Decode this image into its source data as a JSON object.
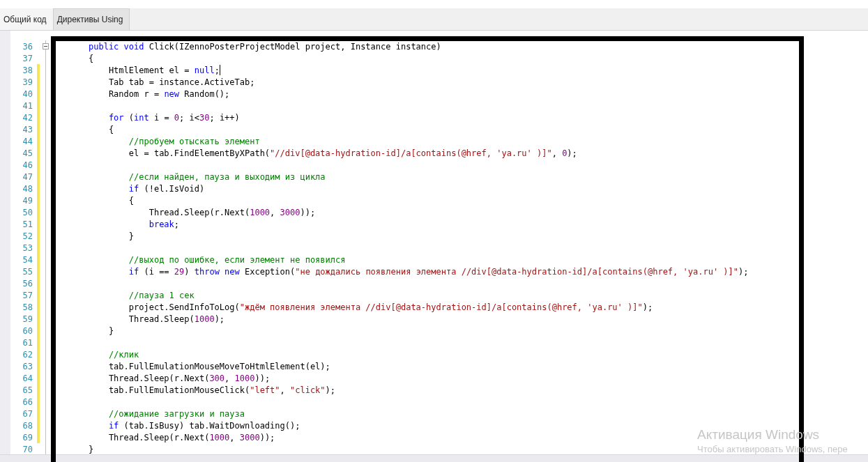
{
  "tabs": [
    {
      "label": "Общий код",
      "selected": true
    },
    {
      "label": "Директивы Using",
      "selected": false
    }
  ],
  "editor": {
    "lines": [
      {
        "number": "36",
        "changed": false,
        "fold_toggle": true,
        "caret": false,
        "tokens": [
          {
            "kind": "keyword",
            "text": "public"
          },
          {
            "kind": "keyword",
            "text": " void"
          },
          {
            "kind": "plain",
            "text": " Click(IZennoPosterProjectModel project, Instance instance)"
          }
        ]
      },
      {
        "number": "37",
        "changed": false,
        "fold_toggle": false,
        "caret": false,
        "tokens": [
          {
            "kind": "plain",
            "text": "{"
          }
        ]
      },
      {
        "number": "38",
        "changed": true,
        "fold_toggle": false,
        "caret": true,
        "tokens": [
          {
            "kind": "plain",
            "text": "    HtmlElement el = "
          },
          {
            "kind": "keyword",
            "text": "null"
          },
          {
            "kind": "plain",
            "text": ";"
          }
        ]
      },
      {
        "number": "39",
        "changed": true,
        "fold_toggle": false,
        "caret": false,
        "tokens": [
          {
            "kind": "plain",
            "text": "    Tab tab = instance.ActiveTab;"
          }
        ]
      },
      {
        "number": "40",
        "changed": true,
        "fold_toggle": false,
        "caret": false,
        "tokens": [
          {
            "kind": "plain",
            "text": "    Random r = "
          },
          {
            "kind": "keyword",
            "text": "new"
          },
          {
            "kind": "plain",
            "text": " Random();"
          }
        ]
      },
      {
        "number": "41",
        "changed": true,
        "fold_toggle": false,
        "caret": false
      },
      {
        "number": "42",
        "changed": true,
        "fold_toggle": false,
        "caret": false,
        "tokens": [
          {
            "kind": "keyword",
            "text": "    for"
          },
          {
            "kind": "plain",
            "text": " ("
          },
          {
            "kind": "keyword",
            "text": "int"
          },
          {
            "kind": "plain",
            "text": " i = "
          },
          {
            "kind": "number",
            "text": "0"
          },
          {
            "kind": "plain",
            "text": "; i<"
          },
          {
            "kind": "number",
            "text": "30"
          },
          {
            "kind": "plain",
            "text": "; i++)"
          }
        ]
      },
      {
        "number": "43",
        "changed": true,
        "fold_toggle": false,
        "caret": false,
        "tokens": [
          {
            "kind": "plain",
            "text": "    {"
          }
        ]
      },
      {
        "number": "44",
        "changed": true,
        "fold_toggle": false,
        "caret": false,
        "tokens": [
          {
            "kind": "comment",
            "text": "        //пробуем отыскать элемент"
          }
        ]
      },
      {
        "number": "45",
        "changed": true,
        "fold_toggle": false,
        "caret": false,
        "tokens": [
          {
            "kind": "plain",
            "text": "        el = tab.FindElementByXPath("
          },
          {
            "kind": "string",
            "text": "\"//div[@data-hydration-id]/a[contains(@href, 'ya.ru' )]\""
          },
          {
            "kind": "plain",
            "text": ", "
          },
          {
            "kind": "number",
            "text": "0"
          },
          {
            "kind": "plain",
            "text": ");"
          }
        ]
      },
      {
        "number": "46",
        "changed": true,
        "fold_toggle": false,
        "caret": false
      },
      {
        "number": "47",
        "changed": true,
        "fold_toggle": false,
        "caret": false,
        "tokens": [
          {
            "kind": "comment",
            "text": "        //если найден, пауза и выходим из цикла"
          }
        ]
      },
      {
        "number": "48",
        "changed": true,
        "fold_toggle": false,
        "caret": false,
        "tokens": [
          {
            "kind": "keyword",
            "text": "        if"
          },
          {
            "kind": "plain",
            "text": " (!el.IsVoid)"
          }
        ]
      },
      {
        "number": "49",
        "changed": true,
        "fold_toggle": false,
        "caret": false,
        "tokens": [
          {
            "kind": "plain",
            "text": "        {"
          }
        ]
      },
      {
        "number": "50",
        "changed": true,
        "fold_toggle": false,
        "caret": false,
        "tokens": [
          {
            "kind": "plain",
            "text": "            Thread.Sleep(r.Next("
          },
          {
            "kind": "number",
            "text": "1000"
          },
          {
            "kind": "plain",
            "text": ", "
          },
          {
            "kind": "number",
            "text": "3000"
          },
          {
            "kind": "plain",
            "text": "));"
          }
        ]
      },
      {
        "number": "51",
        "changed": true,
        "fold_toggle": false,
        "caret": false,
        "tokens": [
          {
            "kind": "keyword",
            "text": "            break"
          },
          {
            "kind": "plain",
            "text": ";"
          }
        ]
      },
      {
        "number": "52",
        "changed": true,
        "fold_toggle": false,
        "caret": false,
        "tokens": [
          {
            "kind": "plain",
            "text": "        }"
          }
        ]
      },
      {
        "number": "53",
        "changed": true,
        "fold_toggle": false,
        "caret": false
      },
      {
        "number": "54",
        "changed": true,
        "fold_toggle": false,
        "caret": false,
        "tokens": [
          {
            "kind": "comment",
            "text": "        //выход по ошибке, если элемент не появился"
          }
        ]
      },
      {
        "number": "55",
        "changed": true,
        "fold_toggle": false,
        "caret": false,
        "tokens": [
          {
            "kind": "keyword",
            "text": "        if"
          },
          {
            "kind": "plain",
            "text": " (i == "
          },
          {
            "kind": "number",
            "text": "29"
          },
          {
            "kind": "plain",
            "text": ") "
          },
          {
            "kind": "keyword",
            "text": "throw"
          },
          {
            "kind": "keyword",
            "text": " new"
          },
          {
            "kind": "plain",
            "text": " Exception("
          },
          {
            "kind": "string",
            "text": "\"не дождались появления элемента //div[@data-hydration-id]/a[contains(@href, 'ya.ru' )]\""
          },
          {
            "kind": "plain",
            "text": ");"
          }
        ]
      },
      {
        "number": "56",
        "changed": true,
        "fold_toggle": false,
        "caret": false
      },
      {
        "number": "57",
        "changed": true,
        "fold_toggle": false,
        "caret": false,
        "tokens": [
          {
            "kind": "comment",
            "text": "        //пауза 1 сек"
          }
        ]
      },
      {
        "number": "58",
        "changed": true,
        "fold_toggle": false,
        "caret": false,
        "tokens": [
          {
            "kind": "plain",
            "text": "        project.SendInfoToLog("
          },
          {
            "kind": "string",
            "text": "\"ждём появления элемента //div[@data-hydration-id]/a[contains(@href, 'ya.ru' )]\""
          },
          {
            "kind": "plain",
            "text": ");"
          }
        ]
      },
      {
        "number": "59",
        "changed": true,
        "fold_toggle": false,
        "caret": false,
        "tokens": [
          {
            "kind": "plain",
            "text": "        Thread.Sleep("
          },
          {
            "kind": "number",
            "text": "1000"
          },
          {
            "kind": "plain",
            "text": ");"
          }
        ]
      },
      {
        "number": "60",
        "changed": true,
        "fold_toggle": false,
        "caret": false,
        "tokens": [
          {
            "kind": "plain",
            "text": "    }"
          }
        ]
      },
      {
        "number": "61",
        "changed": true,
        "fold_toggle": false,
        "caret": false
      },
      {
        "number": "62",
        "changed": true,
        "fold_toggle": false,
        "caret": false,
        "tokens": [
          {
            "kind": "comment",
            "text": "    //клик"
          }
        ]
      },
      {
        "number": "63",
        "changed": true,
        "fold_toggle": false,
        "caret": false,
        "tokens": [
          {
            "kind": "plain",
            "text": "    tab.FullEmulationMouseMoveToHtmlElement(el);"
          }
        ]
      },
      {
        "number": "64",
        "changed": true,
        "fold_toggle": false,
        "caret": false,
        "tokens": [
          {
            "kind": "plain",
            "text": "    Thread.Sleep(r.Next("
          },
          {
            "kind": "number",
            "text": "300"
          },
          {
            "kind": "plain",
            "text": ", "
          },
          {
            "kind": "number",
            "text": "1000"
          },
          {
            "kind": "plain",
            "text": "));"
          }
        ]
      },
      {
        "number": "65",
        "changed": true,
        "fold_toggle": false,
        "caret": false,
        "tokens": [
          {
            "kind": "plain",
            "text": "    tab.FullEmulationMouseClick("
          },
          {
            "kind": "string",
            "text": "\"left\""
          },
          {
            "kind": "plain",
            "text": ", "
          },
          {
            "kind": "string",
            "text": "\"click\""
          },
          {
            "kind": "plain",
            "text": ");"
          }
        ]
      },
      {
        "number": "66",
        "changed": true,
        "fold_toggle": false,
        "caret": false
      },
      {
        "number": "67",
        "changed": true,
        "fold_toggle": false,
        "caret": false,
        "tokens": [
          {
            "kind": "comment",
            "text": "    //ожидание загрузки и пауза"
          }
        ]
      },
      {
        "number": "68",
        "changed": true,
        "fold_toggle": false,
        "caret": false,
        "tokens": [
          {
            "kind": "keyword",
            "text": "    if"
          },
          {
            "kind": "plain",
            "text": " (tab.IsBusy) tab.WaitDownloading();"
          }
        ]
      },
      {
        "number": "69",
        "changed": true,
        "fold_toggle": false,
        "caret": false,
        "tokens": [
          {
            "kind": "plain",
            "text": "    Thread.Sleep(r.Next("
          },
          {
            "kind": "number",
            "text": "1000"
          },
          {
            "kind": "plain",
            "text": ", "
          },
          {
            "kind": "number",
            "text": "3000"
          },
          {
            "kind": "plain",
            "text": "));"
          }
        ]
      },
      {
        "number": "70",
        "changed": false,
        "fold_toggle": false,
        "caret": false,
        "tokens": [
          {
            "kind": "plain",
            "text": "}"
          }
        ]
      }
    ]
  },
  "activation_notice": {
    "title": "Активация Windows",
    "text": "Чтобы активировать Windows, пере"
  }
}
